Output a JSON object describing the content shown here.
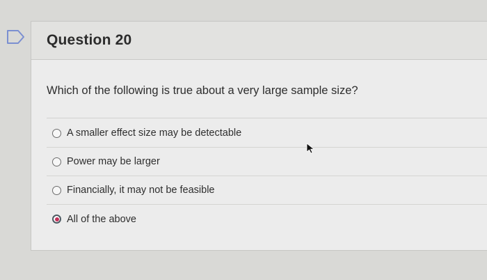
{
  "question": {
    "title": "Question 20",
    "text": "Which of the following is true about a very large sample size?",
    "answers": [
      {
        "label": "A smaller effect size may be detectable",
        "selected": false
      },
      {
        "label": "Power may be larger",
        "selected": false
      },
      {
        "label": "Financially, it may not be feasible",
        "selected": false
      },
      {
        "label": "All of the above",
        "selected": true
      }
    ]
  },
  "icons": {
    "flag": "flag-icon",
    "cursor": "mouse-cursor-icon"
  },
  "colors": {
    "selected_radio": "#c4305a",
    "flag_stroke": "#7b8fd1"
  }
}
